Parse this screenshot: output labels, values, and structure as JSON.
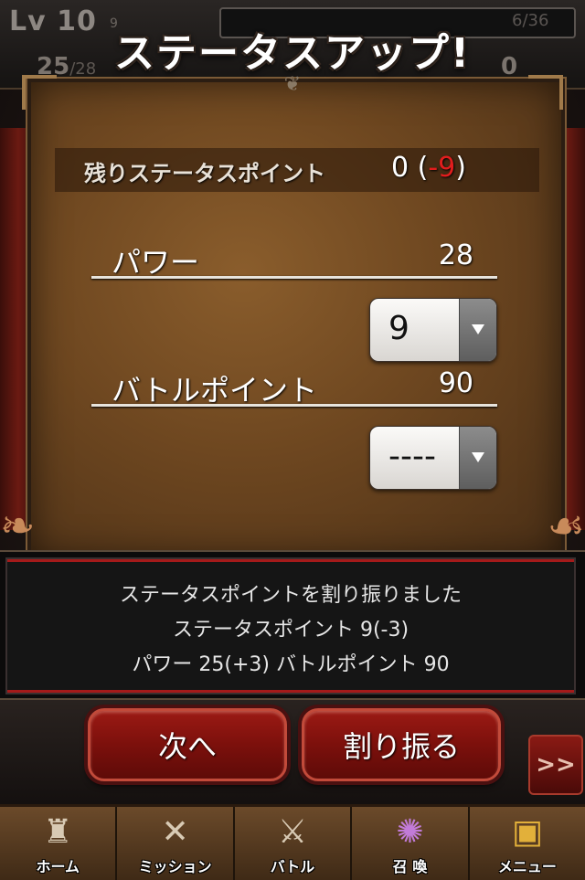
{
  "hud": {
    "level": "Lv 10",
    "level_small": "9",
    "exp_text": "6/36",
    "hp_current": "25",
    "hp_max": "/28",
    "bp_value": "0"
  },
  "dialog": {
    "title": "ステータスアップ!",
    "remaining_label": "残りステータスポイント",
    "remaining_value": "0",
    "remaining_change": "-9"
  },
  "stats": [
    {
      "label": "パワー",
      "value": "28",
      "select_value": "9"
    },
    {
      "label": "バトルポイント",
      "value": "90",
      "select_value": "----"
    }
  ],
  "message": {
    "lines": [
      "ステータスポイントを割り振りました",
      "ステータスポイント 9(-3)",
      "パワー 25(+3) バトルポイント 90"
    ]
  },
  "buttons": {
    "next_label": "次へ",
    "assign_label": "割り振る",
    "skip_label": ">>"
  },
  "tabs": [
    {
      "label": "ホーム",
      "icon": "castle-icon"
    },
    {
      "label": "ミッション",
      "icon": "map-icon"
    },
    {
      "label": "バトル",
      "icon": "axe-icon"
    },
    {
      "label": "召 喚",
      "icon": "portal-icon"
    },
    {
      "label": "メニュー",
      "icon": "book-icon"
    }
  ],
  "colors": {
    "negative": "#e11d1d",
    "button_red": "#8a1410",
    "parchment": "#7a5125"
  }
}
